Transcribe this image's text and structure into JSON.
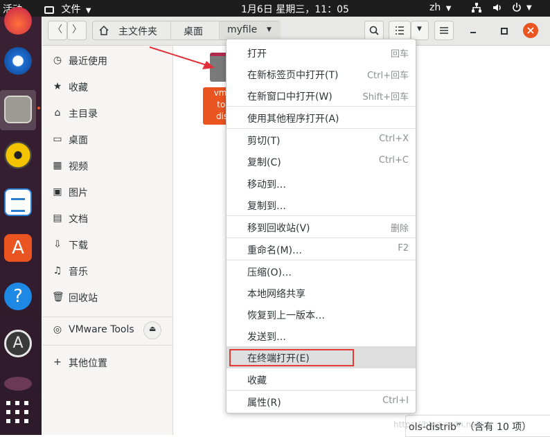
{
  "topbar": {
    "activities": "活动",
    "app_menu": "文件",
    "clock": "1月6日 星期三，11：05",
    "lang": "zh"
  },
  "headerbar": {
    "path": [
      "主文件夹",
      "桌面",
      "myfile"
    ]
  },
  "sidebar": {
    "items": [
      {
        "icon": "recent-icon",
        "label": "最近使用"
      },
      {
        "icon": "star-icon",
        "label": "收藏"
      },
      {
        "icon": "home-icon",
        "label": "主目录"
      },
      {
        "icon": "desktop-icon",
        "label": "桌面"
      },
      {
        "icon": "video-icon",
        "label": "视频"
      },
      {
        "icon": "picture-icon",
        "label": "图片"
      },
      {
        "icon": "document-icon",
        "label": "文档"
      },
      {
        "icon": "download-icon",
        "label": "下载"
      },
      {
        "icon": "music-icon",
        "label": "音乐"
      },
      {
        "icon": "trash-icon",
        "label": "回收站"
      }
    ],
    "device": "VMware Tools",
    "other": "其他位置"
  },
  "file": {
    "label_lines": [
      "vmw",
      "too",
      "dist"
    ]
  },
  "status": {
    "text": "ols-distrib” （含有 10 项）",
    "watermark": "https://blog.csdn.net/..."
  },
  "menu": {
    "items": [
      {
        "label": "打开",
        "shortcut": "回车"
      },
      {
        "label": "在新标签页中打开(T)",
        "shortcut": "Ctrl+回车"
      },
      {
        "label": "在新窗口中打开(W)",
        "shortcut": "Shift+回车"
      },
      {
        "label": "使用其他程序打开(A)",
        "shortcut": ""
      },
      {
        "label": "剪切(T)",
        "shortcut": "Ctrl+X"
      },
      {
        "label": "复制(C)",
        "shortcut": "Ctrl+C"
      },
      {
        "label": "移动到…",
        "shortcut": ""
      },
      {
        "label": "复制到…",
        "shortcut": ""
      },
      {
        "label": "移到回收站(V)",
        "shortcut": "删除"
      },
      {
        "label": "重命名(M)…",
        "shortcut": "F2"
      },
      {
        "label": "压缩(O)…",
        "shortcut": ""
      },
      {
        "label": "本地网络共享",
        "shortcut": ""
      },
      {
        "label": "恢复到上一版本…",
        "shortcut": ""
      },
      {
        "label": "发送到…",
        "shortcut": ""
      },
      {
        "label": "在终端打开(E)",
        "shortcut": ""
      },
      {
        "label": "收藏",
        "shortcut": ""
      },
      {
        "label": "属性(R)",
        "shortcut": "Ctrl+I"
      }
    ]
  },
  "colors": {
    "accent_orange": "#e95420",
    "highlight_red": "#e53935",
    "arrow_red": "#e0303a"
  }
}
